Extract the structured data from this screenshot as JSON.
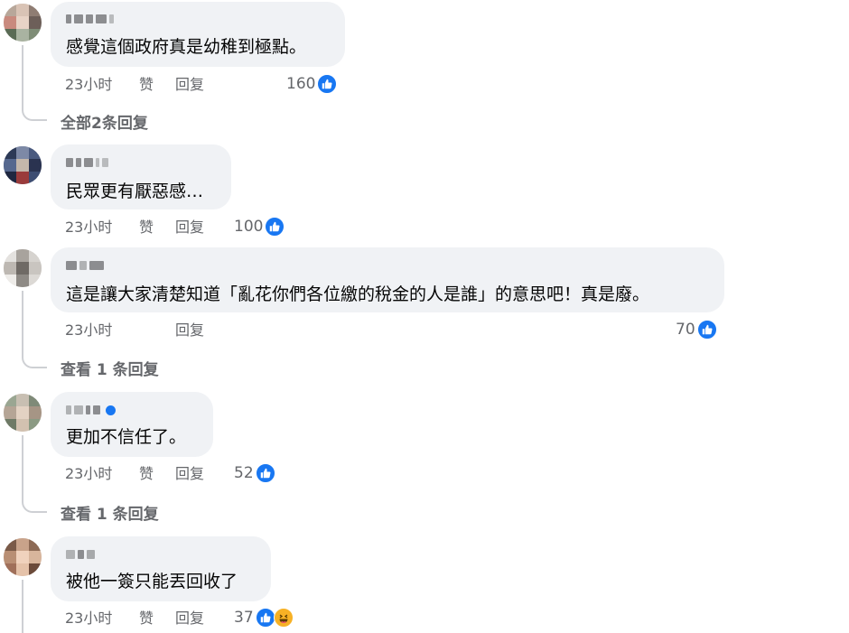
{
  "comments": [
    {
      "text": "感覺這個政府真是幼稚到極點。",
      "time": "23小时",
      "like_label": "赞",
      "reply_label": "回复",
      "likes": "160",
      "reactions": [
        "like-icon"
      ],
      "replies_label": "全部2条回复"
    },
    {
      "text": "民眾更有厭惡感…",
      "time": "23小时",
      "like_label": "赞",
      "reply_label": "回复",
      "likes": "100",
      "reactions": [
        "like-icon"
      ]
    },
    {
      "text": "這是讓大家清楚知道「亂花你們各位繳的稅金的人是誰」的意思吧！真是廢。",
      "time": "23小时",
      "reply_label": "回复",
      "likes": "70",
      "reactions": [
        "like-icon"
      ],
      "replies_label": "查看 1 条回复"
    },
    {
      "text": "更加不信任了。",
      "time": "23小时",
      "like_label": "赞",
      "reply_label": "回复",
      "likes": "52",
      "reactions": [
        "like-icon"
      ],
      "verified": true,
      "replies_label": "查看 1 条回复"
    },
    {
      "text": "被他一簽只能丟回收了",
      "time": "23小时",
      "like_label": "赞",
      "reply_label": "回复",
      "likes": "37",
      "reactions": [
        "like-icon",
        "haha-icon"
      ]
    }
  ],
  "colors": {
    "bubble": "#f0f2f5",
    "like_blue": "#1877f2",
    "meta_gray": "#65676b",
    "thread_line": "#ced0d4",
    "haha_yellow": "#f7b125"
  }
}
